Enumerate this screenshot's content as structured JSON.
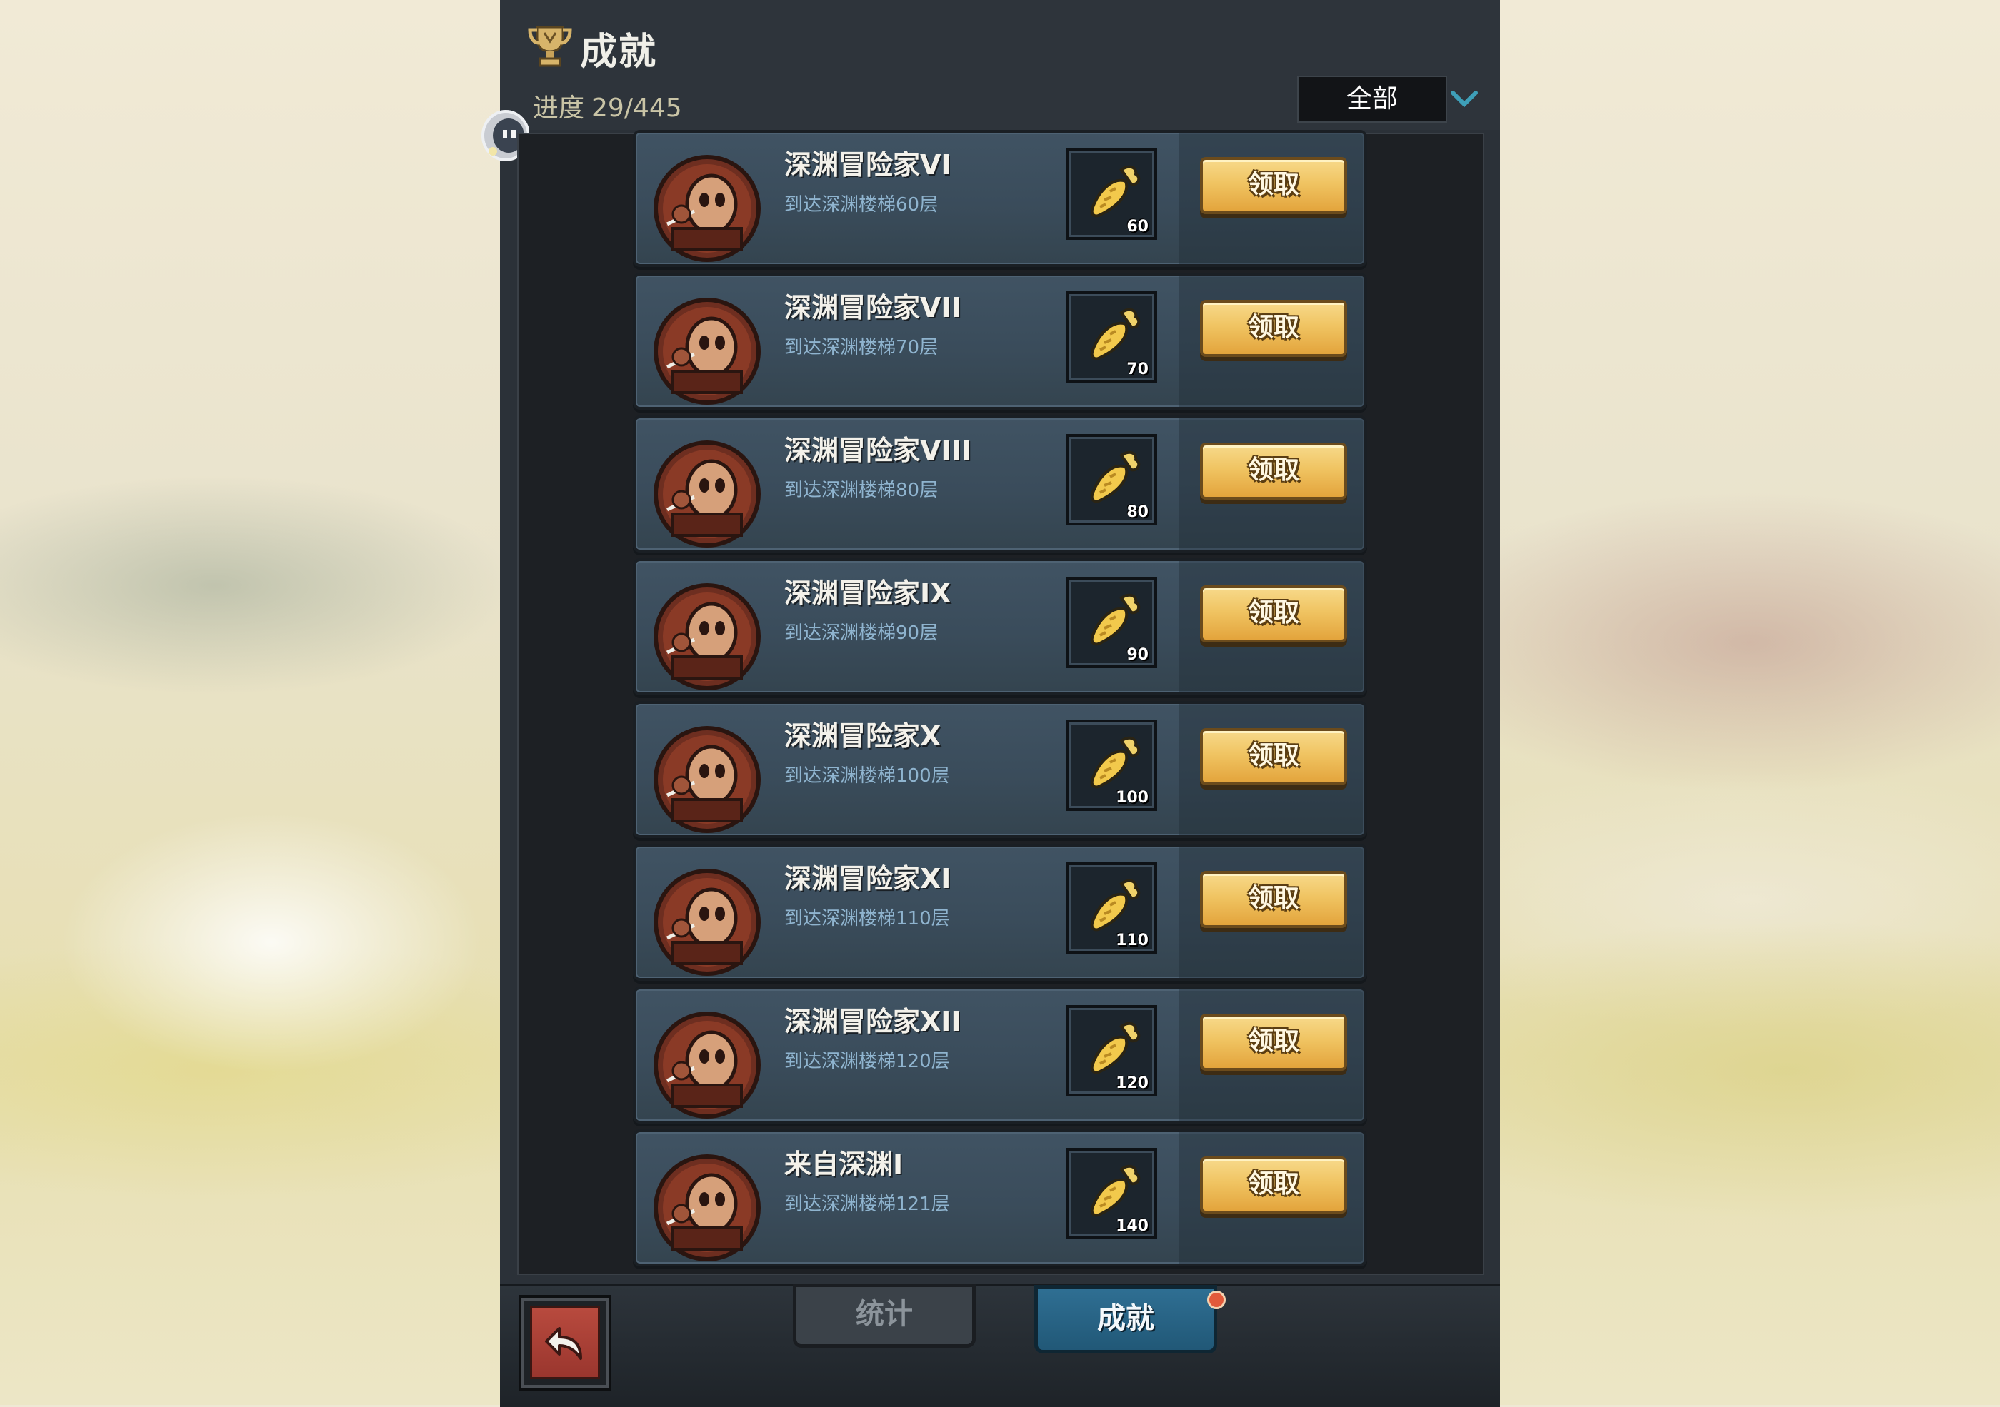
{
  "header": {
    "title": "成就",
    "progress_label": "进度",
    "progress_value": "29/445",
    "filter_value": "全部"
  },
  "achievements": [
    {
      "name": "深渊冒险家VI",
      "desc": "到达深渊楼梯60层",
      "reward": "60",
      "button": "领取"
    },
    {
      "name": "深渊冒险家VII",
      "desc": "到达深渊楼梯70层",
      "reward": "70",
      "button": "领取"
    },
    {
      "name": "深渊冒险家VIII",
      "desc": "到达深渊楼梯80层",
      "reward": "80",
      "button": "领取"
    },
    {
      "name": "深渊冒险家IX",
      "desc": "到达深渊楼梯90层",
      "reward": "90",
      "button": "领取"
    },
    {
      "name": "深渊冒险家X",
      "desc": "到达深渊楼梯100层",
      "reward": "100",
      "button": "领取"
    },
    {
      "name": "深渊冒险家XI",
      "desc": "到达深渊楼梯110层",
      "reward": "110",
      "button": "领取"
    },
    {
      "name": "深渊冒险家XII",
      "desc": "到达深渊楼梯120层",
      "reward": "120",
      "button": "领取"
    },
    {
      "name": "来自深渊I",
      "desc": "到达深渊楼梯121层",
      "reward": "140",
      "button": "领取"
    }
  ],
  "tabs": {
    "stats": "统计",
    "achievements": "成就"
  },
  "icons": {
    "trophy": "trophy-icon",
    "dropdown": "chevron-down-icon",
    "achievement": "masked-warrior-icon",
    "reward": "golden-carrot-icon",
    "back": "back-arrow-icon"
  },
  "colors": {
    "accent": "#3e9fb8",
    "button": "#f0c462",
    "active_tab": "#2f6f93"
  }
}
